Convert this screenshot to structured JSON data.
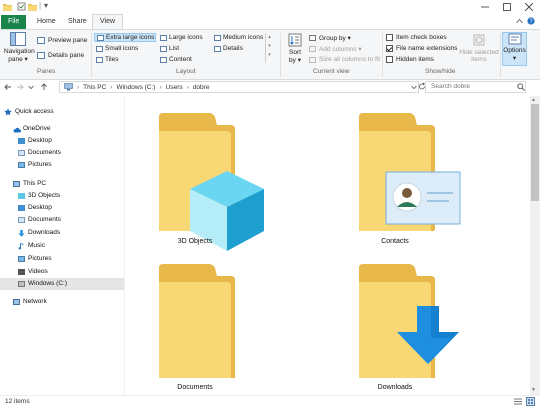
{
  "titlebar": {
    "pin_icon": "|",
    "dropdown_icon": "▾"
  },
  "tabs": {
    "file": "File",
    "home": "Home",
    "share": "Share",
    "view": "View"
  },
  "ribbon": {
    "panes": {
      "navigation_pane": "Navigation",
      "navigation_pane2": "pane ▾",
      "preview_pane": "Preview pane",
      "details_pane": "Details pane",
      "group": "Panes"
    },
    "layout": {
      "extra_large_icons": "Extra large icons",
      "large_icons": "Large icons",
      "medium_icons": "Medium icons",
      "small_icons": "Small icons",
      "list": "List",
      "details": "Details",
      "tiles": "Tiles",
      "content": "Content",
      "group": "Layout"
    },
    "current_view": {
      "sort_by": "Sort",
      "sort_by2": "by ▾",
      "group_by": "Group by ▾",
      "add_columns": "Add columns ▾",
      "size_all_columns": "Size all columns to fit",
      "group": "Current view"
    },
    "show_hide": {
      "item_check_boxes": "Item check boxes",
      "file_name_extensions": "File name extensions",
      "hidden_items": "Hidden items",
      "hide_selected_items": "Hide selected",
      "hide_selected_items2": "items",
      "group": "Show/hide"
    },
    "options": {
      "label": "Options",
      "arrow": "▾"
    }
  },
  "address": {
    "crumbs": [
      "This PC",
      "Windows (C:)",
      "Users",
      "dobre"
    ],
    "separator": "›",
    "search_placeholder": "Search dobre"
  },
  "nav": {
    "items": [
      {
        "label": "Quick access",
        "level": 0
      },
      {
        "label": "OneDrive",
        "level": 0
      },
      {
        "label": "Desktop",
        "level": 1
      },
      {
        "label": "Documents",
        "level": 1
      },
      {
        "label": "Pictures",
        "level": 1
      },
      {
        "label": "This PC",
        "level": 0
      },
      {
        "label": "3D Objects",
        "level": 1
      },
      {
        "label": "Desktop",
        "level": 1
      },
      {
        "label": "Documents",
        "level": 1
      },
      {
        "label": "Downloads",
        "level": 1
      },
      {
        "label": "Music",
        "level": 1
      },
      {
        "label": "Pictures",
        "level": 1
      },
      {
        "label": "Videos",
        "level": 1
      },
      {
        "label": "Windows (C:)",
        "level": 1
      },
      {
        "label": "Network",
        "level": 0
      }
    ]
  },
  "folders": [
    {
      "label": "3D Objects"
    },
    {
      "label": "Contacts"
    },
    {
      "label": "Documents"
    },
    {
      "label": "Downloads"
    }
  ],
  "status": {
    "count": "12 items"
  },
  "colors": {
    "file_tab": "#19854a",
    "folder": "#f8d775",
    "folder_back": "#e8b94a",
    "selection": "#cce4f7"
  }
}
